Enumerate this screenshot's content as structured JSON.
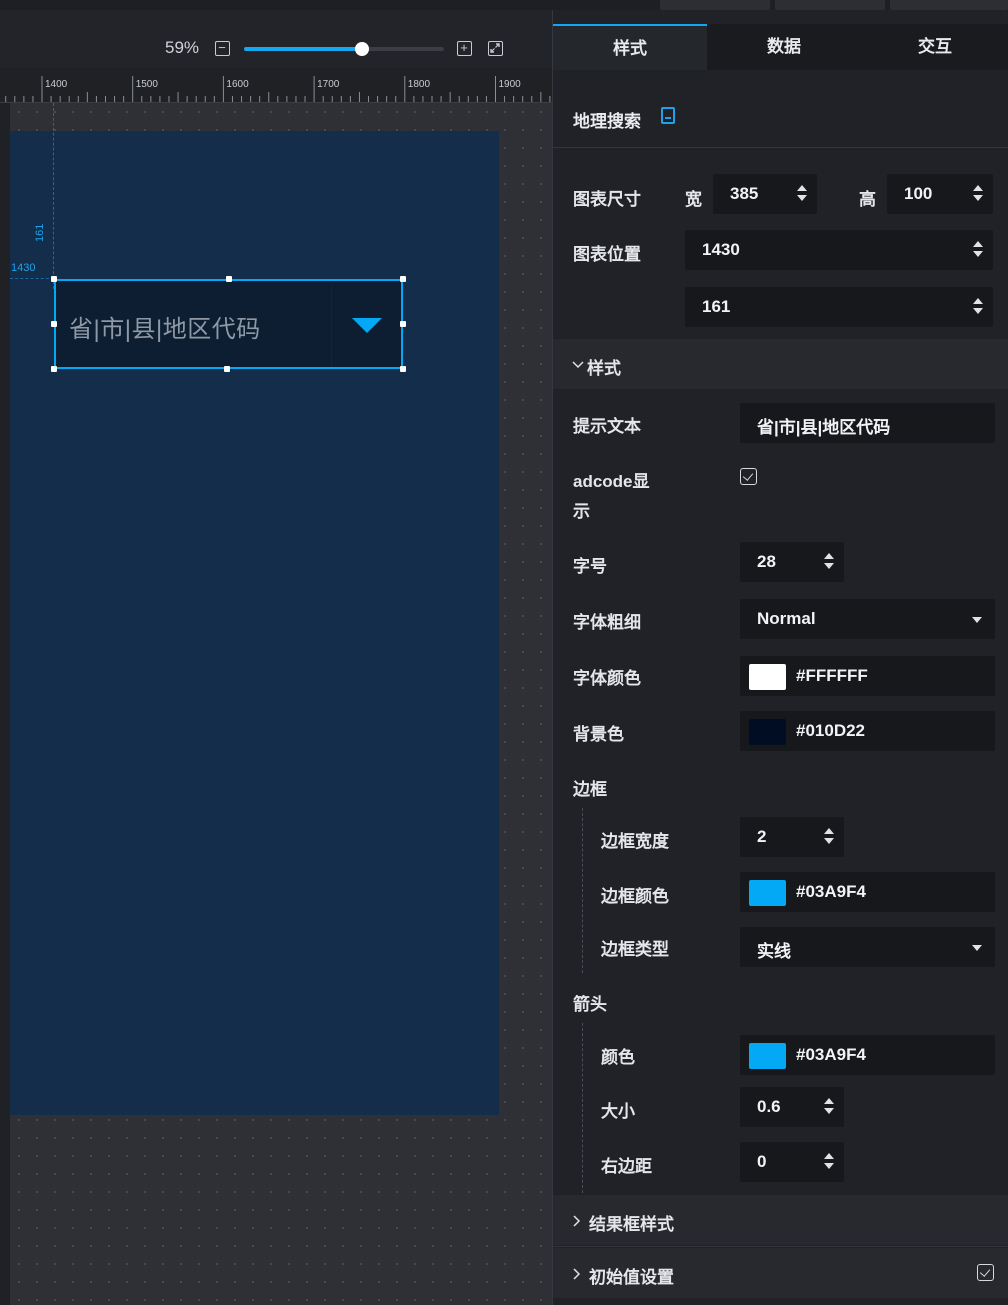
{
  "canvas": {
    "zoom_label": "59%",
    "zoom_level": 0.59,
    "ruler_ticks": [
      "1400",
      "1500",
      "1600",
      "1700",
      "1800",
      "1900"
    ],
    "guide_x_label": "1430",
    "guide_y_label": "161",
    "widget": {
      "placeholder": "省|市|县|地区代码",
      "arrow_color": "#03A9F4",
      "border_color": "#03A9F4"
    }
  },
  "panel": {
    "tabs": [
      {
        "label": "样式"
      },
      {
        "label": "数据"
      },
      {
        "label": "交互"
      }
    ],
    "title": "地理搜索",
    "size": {
      "label": "图表尺寸",
      "width_label": "宽",
      "width_value": "385",
      "height_label": "高",
      "height_value": "100"
    },
    "position": {
      "label": "图表位置",
      "x_value": "1430",
      "y_value": "161"
    },
    "style_section": {
      "title": "样式",
      "hint_label": "提示文本",
      "hint_value": "省|市|县|地区代码",
      "adcode_label_1": "adcode显",
      "adcode_label_2": "示",
      "font_size_label": "字号",
      "font_size_value": "28",
      "font_weight_label": "字体粗细",
      "font_weight_value": "Normal",
      "font_color_label": "字体颜色",
      "font_color_value": "#FFFFFF",
      "bg_color_label": "背景色",
      "bg_color_value": "#010D22",
      "border_label": "边框",
      "border_width_label": "边框宽度",
      "border_width_value": "2",
      "border_color_label": "边框颜色",
      "border_color_value": "#03A9F4",
      "border_type_label": "边框类型",
      "border_type_value": "实线",
      "arrow_label": "箭头",
      "arrow_color_label": "颜色",
      "arrow_color_value": "#03A9F4",
      "arrow_size_label": "大小",
      "arrow_size_value": "0.6",
      "arrow_margin_label": "右边距",
      "arrow_margin_value": "0"
    },
    "result_section": {
      "title": "结果框样式"
    },
    "initial_section": {
      "title": "初始值设置"
    }
  }
}
